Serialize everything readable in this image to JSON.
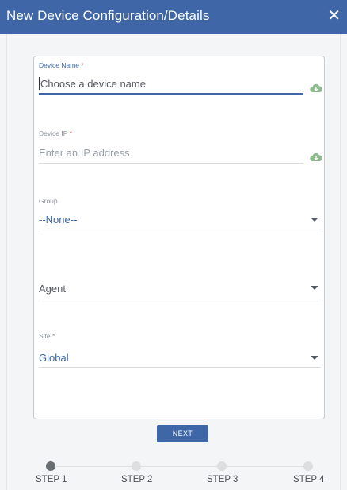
{
  "dialog": {
    "title": "New Device Configuration/Details",
    "close_glyph": "✕",
    "close_icon": "close-icon",
    "accent_color": "#3f67a8"
  },
  "form": {
    "device_name": {
      "label": "Device Name",
      "required_mark": "*",
      "placeholder": "Choose a device name",
      "value": "",
      "icon": "cloud-download-icon"
    },
    "device_ip": {
      "label": "Device IP",
      "required_mark": "*",
      "placeholder": "Enter an IP address",
      "value": "",
      "icon": "cloud-download-icon"
    },
    "group": {
      "label": "Group",
      "selected": "--None--",
      "icon": "chevron-down-icon"
    },
    "agent": {
      "label": "",
      "selected": "Agent",
      "icon": "chevron-down-icon"
    },
    "site": {
      "label": "Site",
      "required_mark": "*",
      "selected": "Global",
      "icon": "chevron-down-icon"
    }
  },
  "actions": {
    "next_label": "NEXT"
  },
  "stepper": {
    "current_step": 1,
    "steps": [
      {
        "label": "STEP 1"
      },
      {
        "label": "STEP 2"
      },
      {
        "label": "STEP 3"
      },
      {
        "label": "STEP 4"
      }
    ]
  }
}
